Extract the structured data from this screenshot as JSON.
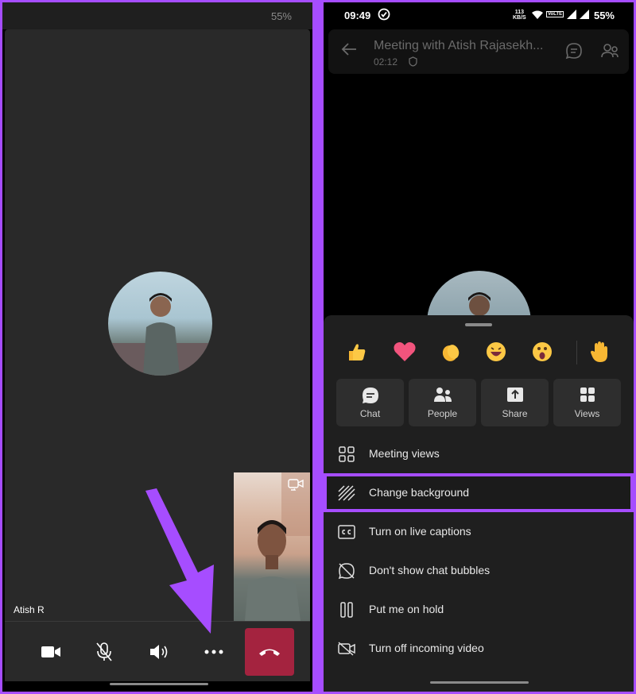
{
  "left_phone": {
    "status": {
      "battery": "55%"
    },
    "participant_name": "Atish R",
    "controls": {
      "camera": "camera-icon",
      "mic": "mic-off-icon",
      "speaker": "speaker-icon",
      "more": "more-icon",
      "end_call": "hang-up-icon",
      "end_call_color": "#a4233f"
    },
    "annotation_color": "#a64dff"
  },
  "right_phone": {
    "status": {
      "time": "09:49",
      "speed_value": "113",
      "speed_unit": "KB/S",
      "volte": "VoLTE",
      "battery": "55%"
    },
    "header": {
      "title": "Meeting with Atish Rajasekh...",
      "timer": "02:12"
    },
    "reactions": [
      "👍",
      "💗",
      "👏",
      "😆",
      "😮",
      "✋"
    ],
    "actions": [
      {
        "label": "Chat",
        "icon": "chat-icon"
      },
      {
        "label": "People",
        "icon": "people-icon"
      },
      {
        "label": "Share",
        "icon": "share-icon"
      },
      {
        "label": "Views",
        "icon": "views-icon"
      }
    ],
    "menu": [
      {
        "label": "Meeting views",
        "icon": "grid-icon"
      },
      {
        "label": "Change background",
        "icon": "background-icon",
        "highlighted": true
      },
      {
        "label": "Turn on live captions",
        "icon": "captions-icon"
      },
      {
        "label": "Don't show chat bubbles",
        "icon": "chat-bubble-off-icon"
      },
      {
        "label": "Put me on hold",
        "icon": "pause-icon"
      },
      {
        "label": "Turn off incoming video",
        "icon": "video-off-icon"
      }
    ],
    "highlight_color": "#a64dff"
  }
}
